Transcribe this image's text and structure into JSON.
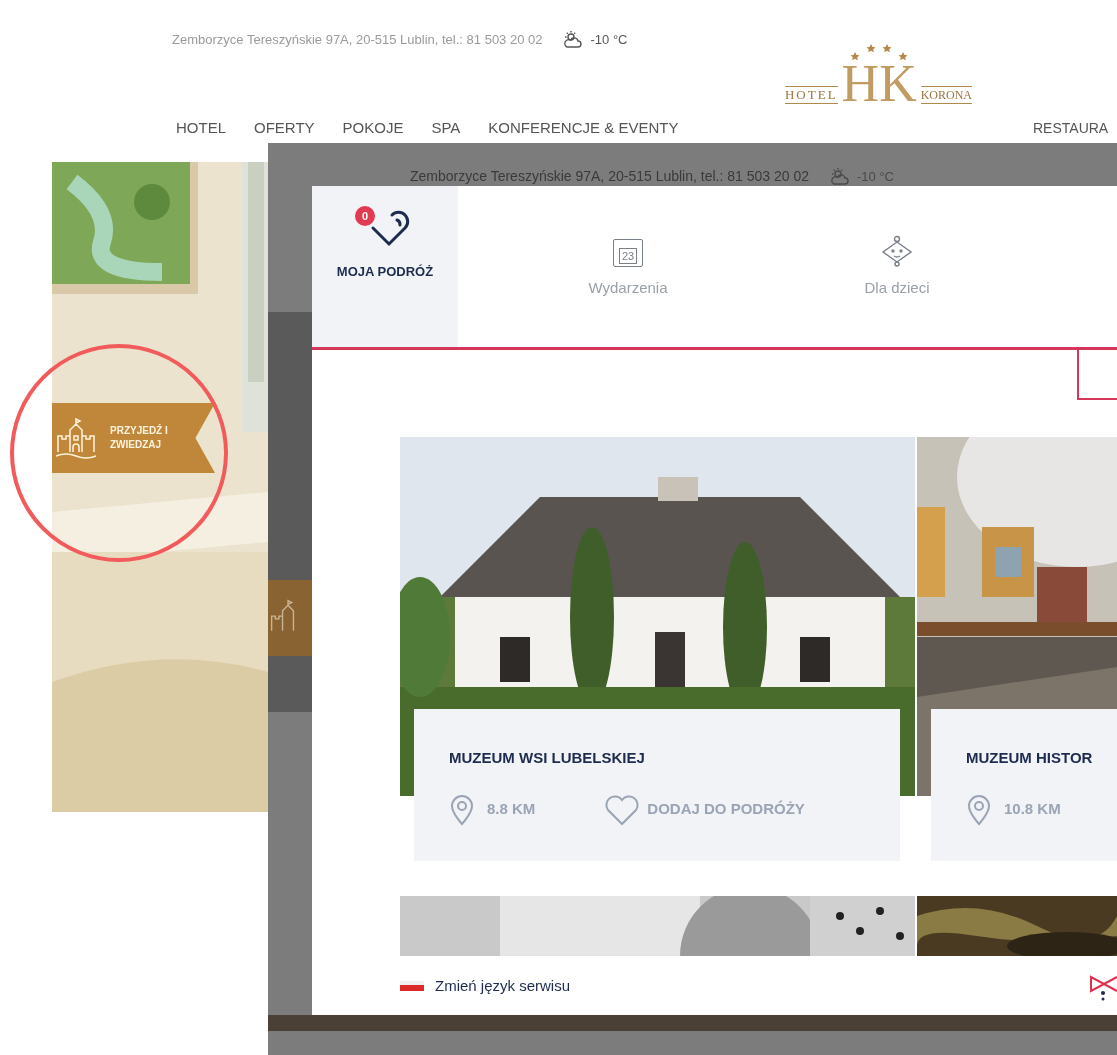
{
  "header": {
    "address": "Zemborzyce Tereszyńskie 97A, 20-515 Lublin, tel.: 81 503 20 02",
    "temperature": "-10 °C"
  },
  "logo": {
    "left": "HOTEL",
    "monogram": "HK",
    "right": "KORONA"
  },
  "nav": [
    "HOTEL",
    "OFERTY",
    "POKOJE",
    "SPA",
    "KONFERENCJE & EVENTY",
    "RESTAURA"
  ],
  "ribbon": {
    "lines": [
      "PRZYJEDŹ I",
      "ZWIEDZAJ"
    ]
  },
  "overlay_header": {
    "address": "Zemborzyce Tereszyńskie 97A, 20-515 Lublin, tel.: 81 503 20 02",
    "temperature": "-10 °C"
  },
  "panel": {
    "tabs": [
      {
        "kind": "trip",
        "label": "MOJA PODRÓŻ",
        "badge": "0",
        "selected": true
      },
      {
        "kind": "events",
        "label": "Wydarzenia",
        "icon_text": "23",
        "selected": false
      },
      {
        "kind": "kids",
        "label": "Dla dzieci",
        "selected": false
      }
    ],
    "places": [
      {
        "name": "MUZEUM WSI LUBELSKIEJ",
        "distance": "8.8 KM",
        "action": "DODAJ DO PODRÓŻY"
      },
      {
        "name": "MUZEUM HISTOR",
        "distance": "10.8 KM"
      }
    ],
    "footer": {
      "language_link": "Zmień język serwisu"
    }
  }
}
